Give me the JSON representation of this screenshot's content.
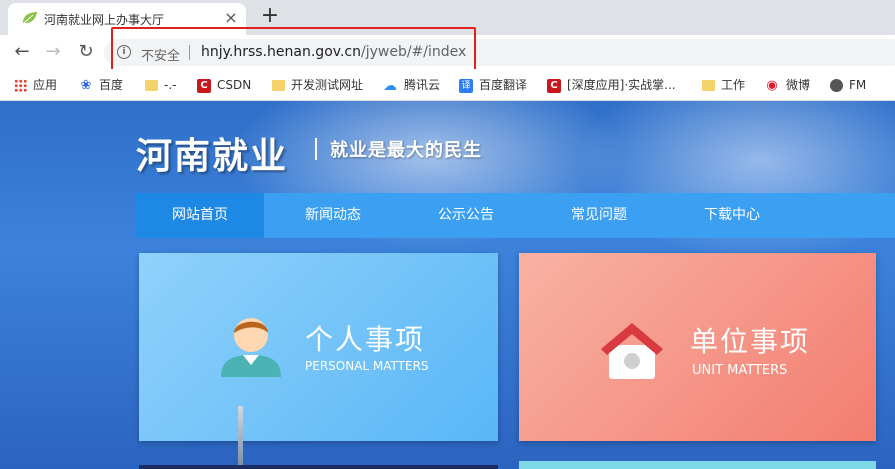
{
  "browser": {
    "tab_title": "河南就业网上办事大厅",
    "close_icon": "×",
    "new_tab_icon": "+",
    "nav": {
      "back": "←",
      "forward": "→",
      "reload": "↻"
    },
    "address": {
      "security_label": "不安全",
      "host": "hnjy.hrss.henan.gov.cn",
      "path": "/jyweb/#/index"
    },
    "bookmarks": [
      {
        "label": "应用",
        "icon": "apps-grid-icon"
      },
      {
        "label": "百度",
        "icon": "baidu-paw-icon"
      },
      {
        "label": "-.-",
        "icon": "folder-icon"
      },
      {
        "label": "CSDN",
        "icon": "csdn-icon"
      },
      {
        "label": "开发测试网址",
        "icon": "folder-icon"
      },
      {
        "label": "腾讯云",
        "icon": "cloud-icon"
      },
      {
        "label": "百度翻译",
        "icon": "translate-icon"
      },
      {
        "label": "[深度应用]·实战掌...",
        "icon": "csdn-icon"
      },
      {
        "label": "工作",
        "icon": "folder-icon"
      },
      {
        "label": "微博",
        "icon": "weibo-icon"
      },
      {
        "label": "FM",
        "icon": "globe-icon"
      }
    ]
  },
  "site": {
    "brand": "河南就业",
    "slogan": "就业是最大的民生",
    "nav": [
      "网站首页",
      "新闻动态",
      "公示公告",
      "常见问题",
      "下载中心"
    ],
    "cards": {
      "personal": {
        "title": "个人事项",
        "subtitle": "PERSONAL MATTERS"
      },
      "unit": {
        "title": "单位事项",
        "subtitle": "UNIT MATTERS"
      }
    }
  },
  "colors": {
    "nav_bar": "#3ba0f2",
    "nav_active": "#1e88e5",
    "card_personal": "#5ab6f7",
    "card_unit": "#f37d6f",
    "highlight_box": "#e02020"
  }
}
